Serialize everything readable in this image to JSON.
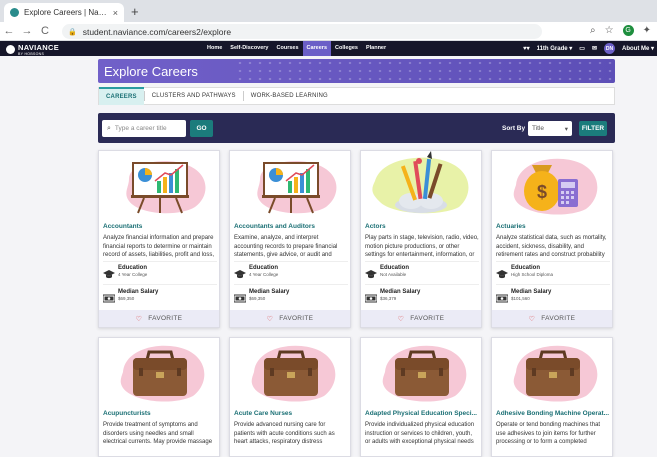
{
  "browser": {
    "tab_title": "Explore Careers | Naviance Stu",
    "tab_close": "×",
    "new_tab": "+",
    "url": "student.naviance.com/careers2/explore",
    "back": "←",
    "forward": "→",
    "reload": "C"
  },
  "topnav": {
    "logo_text": "NAVIANCE",
    "logo_sub": "BY HOBSONS",
    "links": [
      "Home",
      "Self-Discovery",
      "Courses",
      "Careers",
      "Colleges",
      "Planner"
    ],
    "active": "Careers",
    "grade": "11th Grade",
    "initials": "DN",
    "about": "About Me"
  },
  "page": {
    "title": "Explore Careers",
    "tabs": [
      "CAREERS",
      "CLUSTERS AND PATHWAYS",
      "WORK-BASED LEARNING"
    ],
    "search_placeholder": "Type a career title",
    "go_label": "GO",
    "sort_label": "Sort By",
    "sort_value": "Title",
    "filter_label": "FILTER"
  },
  "labels": {
    "education": "Education",
    "salary": "Median Salary",
    "favorite": "FAVORITE"
  },
  "careers": [
    {
      "name": "Accountants",
      "desc": "Analyze financial information and prepare financial reports to determine or maintain record of assets, liabilities, profit and loss, ...",
      "education": "4 Year College",
      "salary": "$69,350",
      "image": "easel-chart"
    },
    {
      "name": "Accountants and Auditors",
      "desc": "Examine, analyze, and interpret accounting records to prepare financial statements, give advice, or audit and evaluate statements p...",
      "education": "4 Year College",
      "salary": "$69,350",
      "image": "easel-chart"
    },
    {
      "name": "Actors",
      "desc": "Play parts in stage, television, radio, video, motion picture productions, or other settings for entertainment, information, or instruct...",
      "education": "Not Available",
      "salary": "$36,379",
      "image": "art-supplies"
    },
    {
      "name": "Actuaries",
      "desc": "Analyze statistical data, such as mortality, accident, sickness, disability, and retirement rates and construct probability tables to fo...",
      "education": "High School Diploma",
      "salary": "$101,560",
      "image": "money-bag"
    },
    {
      "name": "Acupuncturists",
      "desc": "Provide treatment of symptoms and disorders using needles and small electrical currents. May provide massage treatment. ...",
      "image": "briefcase"
    },
    {
      "name": "Acute Care Nurses",
      "desc": "Provide advanced nursing care for patients with acute conditions such as heart attacks, respiratory distress syndrome, or shock. M...",
      "image": "briefcase"
    },
    {
      "name": "Adapted Physical Education Speci...",
      "desc": "Provide individualized physical education instruction or services to children, youth, or adults with exceptional physical needs due ...",
      "image": "briefcase"
    },
    {
      "name": "Adhesive Bonding Machine Operat...",
      "desc": "Operate or tend bonding machines that use adhesives to join items for further processing or to form a completed product. Processes ...",
      "image": "briefcase"
    }
  ]
}
